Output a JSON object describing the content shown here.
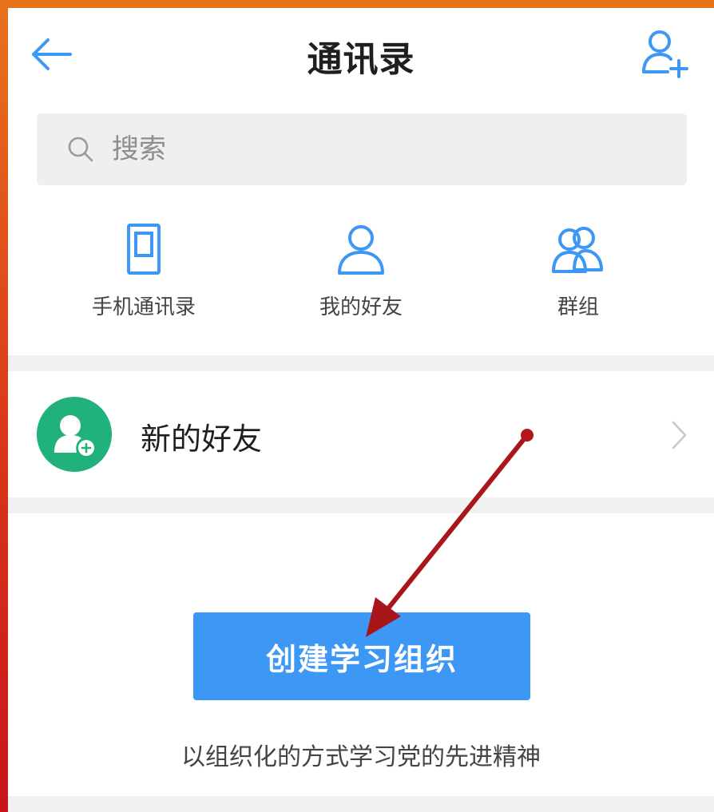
{
  "header": {
    "title": "通讯录",
    "back_icon": "arrow-left-icon",
    "add_icon": "user-plus-icon"
  },
  "search": {
    "placeholder": "搜索",
    "icon": "search-icon"
  },
  "shortcuts": [
    {
      "label": "手机通讯录",
      "icon": "phone-contacts-icon"
    },
    {
      "label": "我的好友",
      "icon": "user-icon"
    },
    {
      "label": "群组",
      "icon": "group-icon"
    }
  ],
  "new_friend": {
    "label": "新的好友",
    "icon": "user-add-avatar-icon"
  },
  "create_org": {
    "button_label": "创建学习组织",
    "tagline": "以组织化的方式学习党的先进精神"
  },
  "colors": {
    "accent_blue": "#3d97f4",
    "icon_blue": "#3d97f4",
    "avatar_green": "#21b17a",
    "annotation_red": "#b3161c",
    "frame_orange": "#e8731c",
    "frame_red": "#c8141a"
  }
}
